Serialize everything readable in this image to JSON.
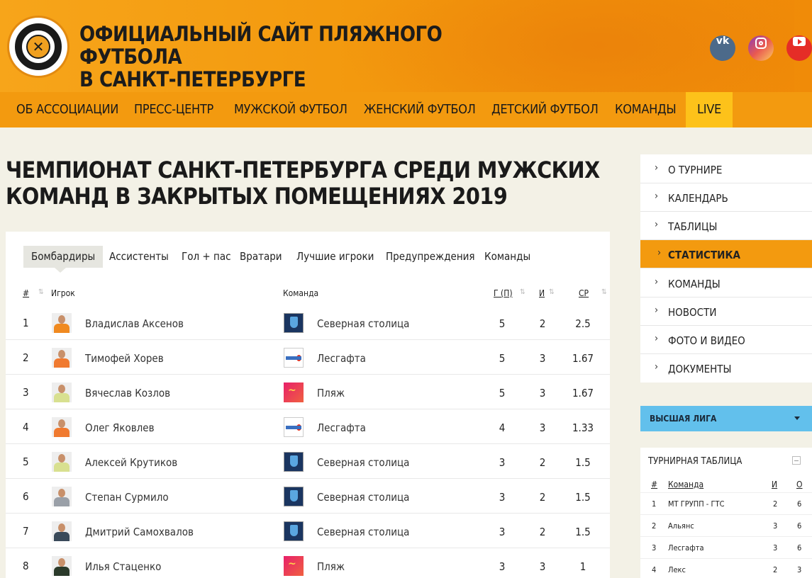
{
  "header": {
    "title_line1": "ОФИЦИАЛЬНЫЙ САЙТ ПЛЯЖНОГО ФУТБОЛА",
    "title_line2": "В САНКТ-ПЕТЕРБУРГЕ",
    "social": [
      "vk-icon",
      "instagram-icon",
      "youtube-icon"
    ]
  },
  "nav": [
    "ОБ АССОЦИАЦИИ",
    "ПРЕСС-ЦЕНТР",
    "МУЖСКОЙ ФУТБОЛ",
    "ЖЕНСКИЙ ФУТБОЛ",
    "ДЕТСКИЙ ФУТБОЛ",
    "КОМАНДЫ",
    "LIVE"
  ],
  "page_title_line1": "ЧЕМПИОНАТ САНКТ-ПЕТЕРБУРГА СРЕДИ МУЖСКИХ",
  "page_title_line2": "КОМАНД В ЗАКРЫТЫХ ПОМЕЩЕНИЯХ 2019",
  "tabs": [
    "Бомбардиры",
    "Ассистенты",
    "Гол + пас",
    "Вратари",
    "Лучшие игроки",
    "Предупреждения",
    "Команды"
  ],
  "active_tab": "Бомбардиры",
  "table": {
    "headers": {
      "num": "#",
      "player": "Игрок",
      "team": "Команда",
      "goals": "Г (П)",
      "games": "И",
      "avg": "СР"
    },
    "rows": [
      {
        "num": "1",
        "player": "Владислав Аксенов",
        "team": "Северная столица",
        "goals": "5",
        "games": "2",
        "avg": "2.5"
      },
      {
        "num": "2",
        "player": "Тимофей Хорев",
        "team": "Лесгафта",
        "goals": "5",
        "games": "3",
        "avg": "1.67"
      },
      {
        "num": "3",
        "player": "Вячеслав Козлов",
        "team": "Пляж",
        "goals": "5",
        "games": "3",
        "avg": "1.67"
      },
      {
        "num": "4",
        "player": "Олег Яковлев",
        "team": "Лесгафта",
        "goals": "4",
        "games": "3",
        "avg": "1.33"
      },
      {
        "num": "5",
        "player": "Алексей Крутиков",
        "team": "Северная столица",
        "goals": "3",
        "games": "2",
        "avg": "1.5"
      },
      {
        "num": "6",
        "player": "Степан Сурмило",
        "team": "Северная столица",
        "goals": "3",
        "games": "2",
        "avg": "1.5"
      },
      {
        "num": "7",
        "player": "Дмитрий Самохвалов",
        "team": "Северная столица",
        "goals": "3",
        "games": "2",
        "avg": "1.5"
      },
      {
        "num": "8",
        "player": "Илья Стаценко",
        "team": "Пляж",
        "goals": "3",
        "games": "3",
        "avg": "1"
      }
    ]
  },
  "sidebar": {
    "items": [
      "О ТУРНИРЕ",
      "КАЛЕНДАРЬ",
      "ТАБЛИЦЫ",
      "СТАТИСТИКА",
      "КОМАНДЫ",
      "НОВОСТИ",
      "ФОТО И ВИДЕО",
      "ДОКУМЕНТЫ"
    ],
    "active": "СТАТИСТИКА"
  },
  "league": {
    "label": "ВЫСШАЯ ЛИГА"
  },
  "standings": {
    "title": "ТУРНИРНАЯ ТАБЛИЦА",
    "headers": {
      "num": "#",
      "team": "Команда",
      "games": "И",
      "points": "О"
    },
    "rows": [
      {
        "num": "1",
        "team": "МТ ГРУПП - ГТС",
        "games": "2",
        "points": "6"
      },
      {
        "num": "2",
        "team": "Альянс",
        "games": "3",
        "points": "6"
      },
      {
        "num": "3",
        "team": "Лесгафта",
        "games": "3",
        "points": "6"
      },
      {
        "num": "4",
        "team": "Лекс",
        "games": "2",
        "points": "3"
      }
    ]
  },
  "colors": {
    "accent": "#f39a0f",
    "live": "#fdc21a",
    "league": "#62c0ec"
  }
}
